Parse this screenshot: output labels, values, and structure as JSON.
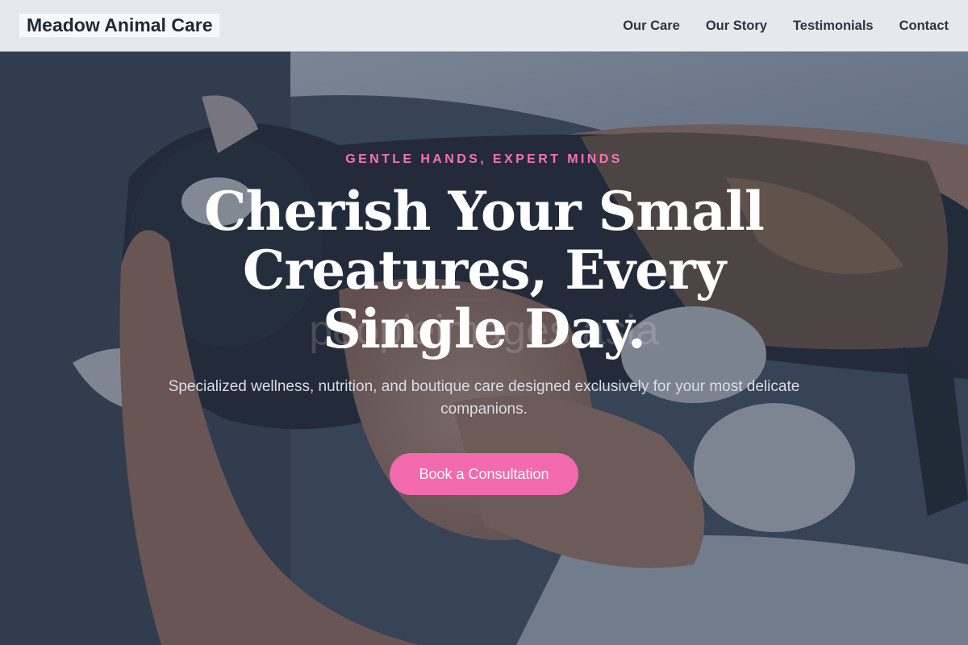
{
  "header": {
    "brand": "Meadow Animal Care",
    "nav": [
      {
        "label": "Our Care"
      },
      {
        "label": "Our Story"
      },
      {
        "label": "Testimonials"
      },
      {
        "label": "Contact"
      }
    ]
  },
  "hero": {
    "eyebrow": "GENTLE HANDS, EXPERT MINDS",
    "headline": "Cherish Your Small Creatures, Every Single Day.",
    "subtext": "Specialized wellness, nutrition, and boutique care designed exclusively for your most delicate companions.",
    "cta_label": "Book a Consultation",
    "watermark": "peopleimages asia"
  },
  "colors": {
    "accent": "#f472b6",
    "button": "#f36aae",
    "header_bg": "#eceef1",
    "nav_text": "#2b3442",
    "overlay": "#283448"
  },
  "background": {
    "image": "photo of a person holding a relaxed black-and-white calico cat"
  }
}
